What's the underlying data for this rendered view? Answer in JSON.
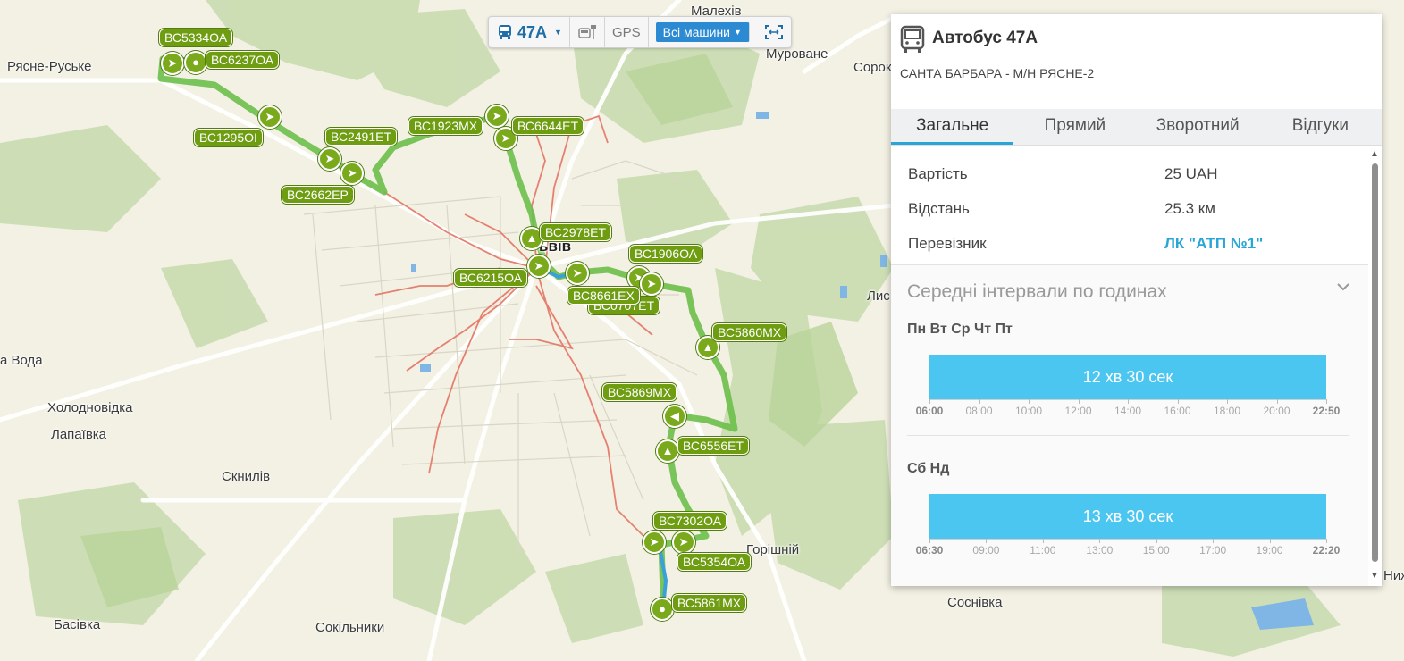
{
  "map": {
    "places": [
      {
        "id": "malekhiv",
        "name": "Малехів"
      },
      {
        "id": "murovane",
        "name": "Муроване"
      },
      {
        "id": "soroky",
        "name": "Сорок"
      },
      {
        "id": "riasne",
        "name": "Рясне-Руське"
      },
      {
        "id": "lviv",
        "name": "ьвів"
      },
      {
        "id": "lys",
        "name": "Лис"
      },
      {
        "id": "voda",
        "name": "а Вода"
      },
      {
        "id": "kholodnovidka",
        "name": "Холодновідка"
      },
      {
        "id": "lapaivka",
        "name": "Лапаївка"
      },
      {
        "id": "sknyliv",
        "name": "Скнилів"
      },
      {
        "id": "horishniy",
        "name": "Горішній"
      },
      {
        "id": "sosnivka",
        "name": "Соснівка"
      },
      {
        "id": "basivka",
        "name": "Басівка"
      },
      {
        "id": "sokilnyky",
        "name": "Сокільники"
      },
      {
        "id": "nyzh",
        "name": "Ниж"
      }
    ],
    "buses": [
      {
        "plate": "ВС5334ОА",
        "icon": "arrow-left-icon"
      },
      {
        "plate": "ВС6237ОА",
        "icon": "stop-dot-icon"
      },
      {
        "plate": "ВС1295ОІ",
        "icon": "arrow-icon"
      },
      {
        "plate": "ВС2491ЕТ",
        "icon": "arrow-icon"
      },
      {
        "plate": "ВС2662ЕР",
        "icon": "arrow-icon"
      },
      {
        "plate": "ВС1923МХ",
        "icon": "arrow-icon"
      },
      {
        "plate": "ВС6644ЕТ",
        "icon": "arrow-icon"
      },
      {
        "plate": "ВС2978ЕТ",
        "icon": "arrow-up-icon"
      },
      {
        "plate": "ВС6215ОА",
        "icon": "arrow-icon"
      },
      {
        "plate": "ВС1906ОА",
        "icon": "arrow-icon"
      },
      {
        "plate": "ВС8661ЕХ",
        "icon": "arrow-right-icon"
      },
      {
        "plate": "ВС0707ЕТ",
        "icon": "arrow-right-icon"
      },
      {
        "plate": "ВС5860МХ",
        "icon": "arrow-up-icon"
      },
      {
        "plate": "ВС5869МХ",
        "icon": "arrow-left-icon"
      },
      {
        "plate": "ВС6556ЕТ",
        "icon": "arrow-up-icon"
      },
      {
        "plate": "ВС7302ОА",
        "icon": "arrow-icon"
      },
      {
        "plate": "ВС5354ОА",
        "icon": "arrow-right-icon"
      },
      {
        "plate": "ВС5861МХ",
        "icon": "stop-dot-icon"
      }
    ]
  },
  "toolbar": {
    "route_label": "47А",
    "gps_label": "GPS",
    "vehicles_label": "Всі машини"
  },
  "panel": {
    "title": "Автобус 47А",
    "subtitle": "САНТА БАРБАРА - М/Н РЯСНЕ-2",
    "tabs": [
      "Загальне",
      "Прямий",
      "Зворотний",
      "Відгуки"
    ],
    "active_tab": 0,
    "info": [
      {
        "label": "Вартість",
        "value": "25 UAH"
      },
      {
        "label": "Відстань",
        "value": "25.3 км"
      },
      {
        "label": "Перевізник",
        "value": "ЛК \"АТП №1\""
      }
    ],
    "intervals_header": "Середні інтервали по годинах",
    "weekdays": {
      "label": "Пн Вт Ср Чт Пт",
      "interval": "12 хв 30 сек",
      "ticks": [
        "06:00",
        "08:00",
        "10:00",
        "12:00",
        "14:00",
        "16:00",
        "18:00",
        "20:00",
        "22:50"
      ]
    },
    "weekend": {
      "label": "Сб Нд",
      "interval": "13 хв 30 сек",
      "ticks": [
        "06:30",
        "09:00",
        "11:00",
        "13:00",
        "15:00",
        "17:00",
        "19:00",
        "22:20"
      ]
    }
  },
  "colors": {
    "route_green": "#6cbf4b",
    "route_blue": "#3aa0d8",
    "secondary_route_red": "#e57b6b",
    "bus_marker": "#7aaa1c",
    "interval_bar": "#4bc6f1",
    "accent_link": "#29a5d6"
  }
}
